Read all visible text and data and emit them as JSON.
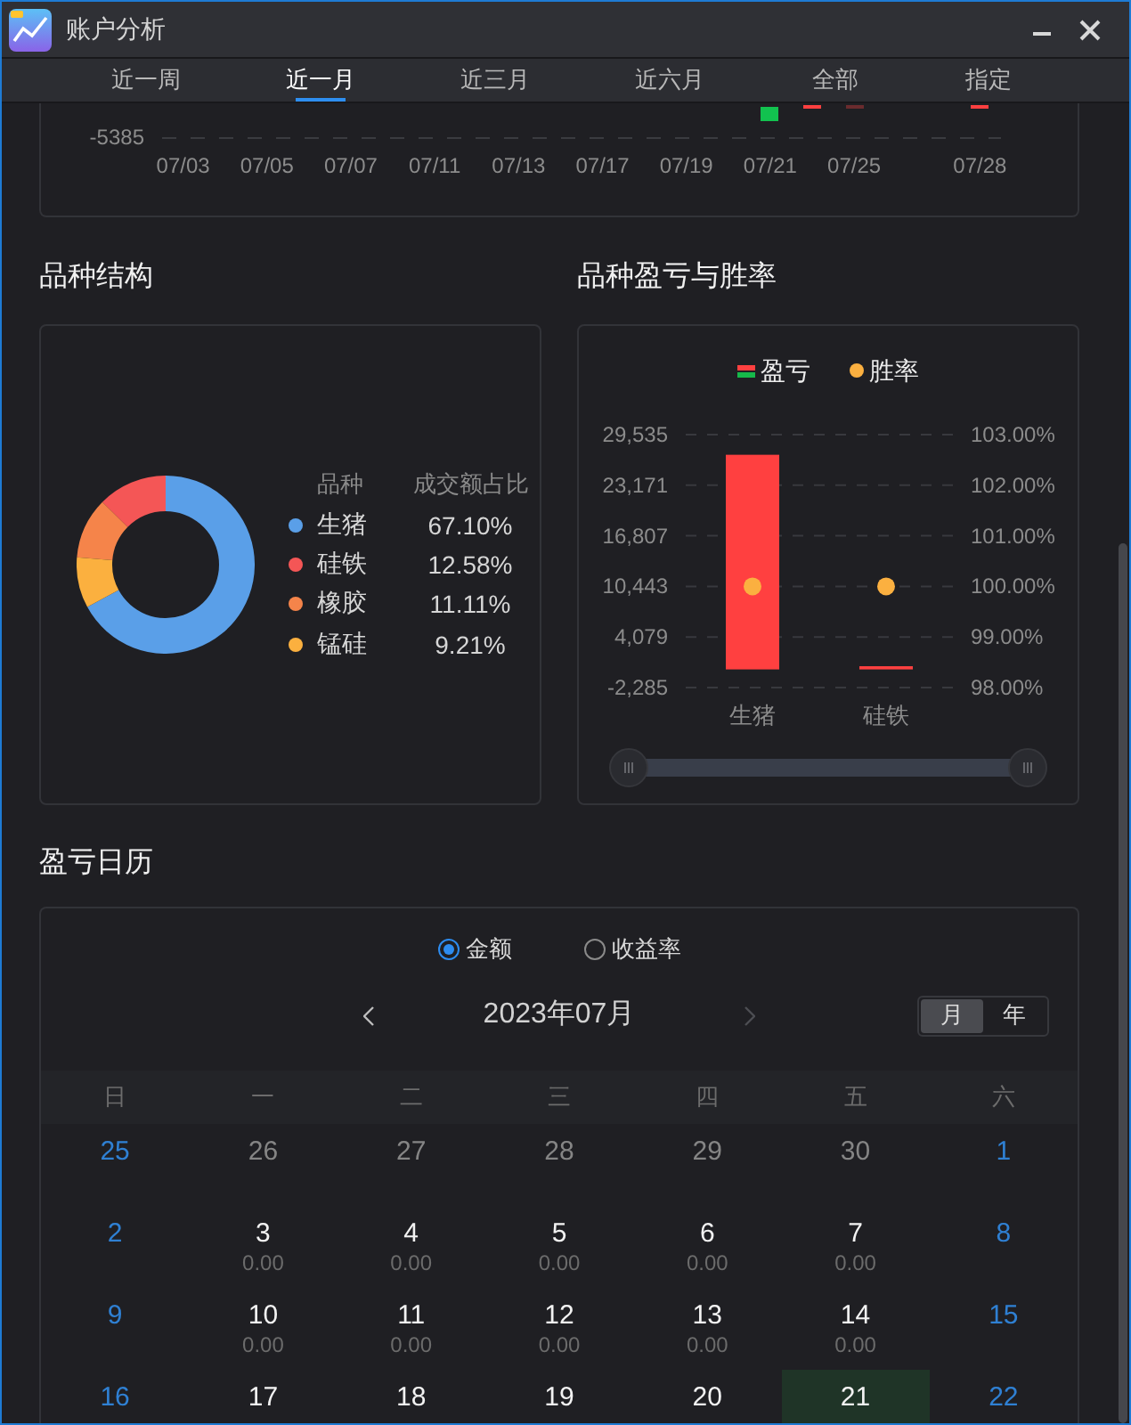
{
  "window": {
    "title": "账户分析"
  },
  "tabs": [
    {
      "label": "近一周",
      "selected": false
    },
    {
      "label": "近一月",
      "selected": true
    },
    {
      "label": "近三月",
      "selected": false
    },
    {
      "label": "近六月",
      "selected": false
    },
    {
      "label": "全部",
      "selected": false
    },
    {
      "label": "指定",
      "selected": false
    }
  ],
  "daily_chart": {
    "y_tick": "-5385",
    "slots": [
      {
        "kind": "plain",
        "label": "07/03"
      },
      {
        "kind": "plain"
      },
      {
        "kind": "plain",
        "label": "07/05"
      },
      {
        "kind": "plain"
      },
      {
        "kind": "plain",
        "label": "07/07"
      },
      {
        "kind": "plain"
      },
      {
        "kind": "plain",
        "label": "07/11"
      },
      {
        "kind": "plain"
      },
      {
        "kind": "plain",
        "label": "07/13"
      },
      {
        "kind": "plain"
      },
      {
        "kind": "plain",
        "label": "07/17"
      },
      {
        "kind": "plain"
      },
      {
        "kind": "plain",
        "label": "07/19"
      },
      {
        "kind": "plain"
      },
      {
        "kind": "loss",
        "label": "07/21"
      },
      {
        "kind": "profit"
      },
      {
        "kind": "muted",
        "label": "07/25"
      },
      {
        "kind": "plain"
      },
      {
        "kind": "plain"
      },
      {
        "kind": "profit",
        "label": "07/28"
      }
    ]
  },
  "structure": {
    "title": "品种结构",
    "chart_data": {
      "type": "donut",
      "categories": [
        "生猪",
        "硅铁",
        "橡胶",
        "锰硅"
      ],
      "series": [
        {
          "name": "成交额占比",
          "values": [
            67.1,
            12.58,
            11.11,
            9.21
          ]
        }
      ]
    },
    "legend": {
      "name_header": "品种",
      "items": [
        {
          "share": "67.10%",
          "color": "#5a9fe8"
        },
        {
          "share": "12.58%",
          "color": "#f45656"
        },
        {
          "share": "11.11%",
          "color": "#f5844a"
        },
        {
          "share": "9.21%",
          "color": "#fbb03f"
        }
      ]
    }
  },
  "pnl": {
    "title": "品种盈亏与胜率",
    "chart_data": {
      "type": "bar",
      "categories": [
        "生猪",
        "硅铁"
      ],
      "series": [
        {
          "name": "盈亏",
          "type": "bar",
          "color": "#ff4040",
          "values": [
            27000,
            400
          ]
        },
        {
          "name": "胜率",
          "type": "scatter",
          "axis": "y2",
          "color": "#fbb040",
          "values": [
            100,
            100
          ]
        }
      ],
      "ylim": [
        -2285,
        29535
      ],
      "yticks": [
        {
          "value": 29535,
          "label": "29,535"
        },
        {
          "value": 23171,
          "label": "23,171"
        },
        {
          "value": 16807,
          "label": "16,807"
        },
        {
          "value": 10443,
          "label": "10,443"
        },
        {
          "value": 4079,
          "label": "4,079"
        },
        {
          "value": -2285,
          "label": "-2,285"
        }
      ],
      "y2lim": [
        98,
        103
      ],
      "y2ticks": [
        {
          "value": 103,
          "label": "103.00%"
        },
        {
          "value": 102,
          "label": "102.00%"
        },
        {
          "value": 101,
          "label": "101.00%"
        },
        {
          "value": 100,
          "label": "100.00%"
        },
        {
          "value": 99,
          "label": "99.00%"
        },
        {
          "value": 98,
          "label": "98.00%"
        }
      ],
      "grid": true
    },
    "zoom": {
      "level": 1
    }
  },
  "calendar": {
    "title": "盈亏日历",
    "modes": [
      {
        "label": "金额",
        "selected": true
      },
      {
        "label": "收益率",
        "selected": false
      }
    ],
    "prev": {
      "disabled": false
    },
    "month": "2023年07月",
    "next": {
      "disabled": true
    },
    "views": [
      {
        "label": "月",
        "selected": true
      },
      {
        "label": "年",
        "selected": false
      }
    ],
    "weekdays": [
      "日",
      "一",
      "二",
      "三",
      "四",
      "五",
      "六"
    ],
    "weeks": [
      [
        {
          "day": "25",
          "kind": "weekend"
        },
        {
          "day": "26",
          "kind": "other"
        },
        {
          "day": "27",
          "kind": "other"
        },
        {
          "day": "28",
          "kind": "other"
        },
        {
          "day": "29",
          "kind": "other"
        },
        {
          "day": "30",
          "kind": "other"
        },
        {
          "day": "1",
          "kind": "weekend"
        }
      ],
      [
        {
          "day": "2",
          "kind": "weekend"
        },
        {
          "day": "3",
          "kind": "weekday",
          "value": "0.00"
        },
        {
          "day": "4",
          "kind": "weekday",
          "value": "0.00"
        },
        {
          "day": "5",
          "kind": "weekday",
          "value": "0.00"
        },
        {
          "day": "6",
          "kind": "weekday",
          "value": "0.00"
        },
        {
          "day": "7",
          "kind": "weekday",
          "value": "0.00"
        },
        {
          "day": "8",
          "kind": "weekend"
        }
      ],
      [
        {
          "day": "9",
          "kind": "weekend"
        },
        {
          "day": "10",
          "kind": "weekday",
          "value": "0.00"
        },
        {
          "day": "11",
          "kind": "weekday",
          "value": "0.00"
        },
        {
          "day": "12",
          "kind": "weekday",
          "value": "0.00"
        },
        {
          "day": "13",
          "kind": "weekday",
          "value": "0.00"
        },
        {
          "day": "14",
          "kind": "weekday",
          "value": "0.00"
        },
        {
          "day": "15",
          "kind": "weekend"
        }
      ],
      [
        {
          "day": "16",
          "kind": "weekend"
        },
        {
          "day": "17",
          "kind": "weekday"
        },
        {
          "day": "18",
          "kind": "weekday"
        },
        {
          "day": "19",
          "kind": "weekday"
        },
        {
          "day": "20",
          "kind": "weekday"
        },
        {
          "day": "21",
          "kind": "loss"
        },
        {
          "day": "22",
          "kind": "weekend"
        }
      ]
    ]
  }
}
